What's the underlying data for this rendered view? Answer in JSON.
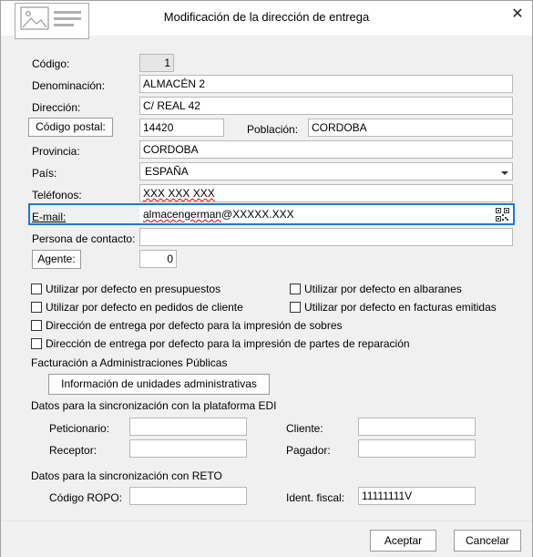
{
  "window": {
    "title": "Modificación de la dirección de entrega",
    "close_glyph": "✕"
  },
  "fields": {
    "codigo": {
      "label": "Código:",
      "value": "1"
    },
    "denominacion": {
      "label": "Denominación:",
      "value": "ALMACÉN 2"
    },
    "direccion": {
      "label": "Dirección:",
      "value": "C/ REAL 42"
    },
    "codigo_postal": {
      "button": "Código postal:",
      "value": "14420"
    },
    "poblacion": {
      "label": "Población:",
      "value": "CORDOBA"
    },
    "provincia": {
      "label": "Provincia:",
      "value": "CORDOBA"
    },
    "pais": {
      "label": "País:",
      "value": "ESPAÑA"
    },
    "telefonos": {
      "label": "Teléfonos:",
      "value": "XXX XXX XXX"
    },
    "email": {
      "label": "E-mail:",
      "value_prefix": "almacengerman",
      "value_suffix": "@XXXXX.XXX"
    },
    "persona_contacto": {
      "label": "Persona de contacto:",
      "value": ""
    },
    "agente": {
      "button": "Agente:",
      "value": "0"
    }
  },
  "checkboxes": [
    {
      "label": "Utilizar por defecto en presupuestos",
      "checked": false
    },
    {
      "label": "Utilizar por defecto en albaranes",
      "checked": false
    },
    {
      "label": "Utilizar por defecto en pedidos de cliente",
      "checked": false
    },
    {
      "label": "Utilizar por defecto en facturas emitidas",
      "checked": false
    },
    {
      "label": "Dirección de entrega por defecto para la impresión de sobres",
      "checked": false
    },
    {
      "label": "Dirección de entrega por defecto para la impresión de partes de reparación",
      "checked": false
    }
  ],
  "facturacion": {
    "heading": "Facturación a Administraciones Públicas",
    "button": "Información de unidades administrativas"
  },
  "edi": {
    "heading": "Datos para la sincronización con la plataforma EDI",
    "peticionario": {
      "label": "Peticionario:",
      "value": ""
    },
    "cliente": {
      "label": "Cliente:",
      "value": ""
    },
    "receptor": {
      "label": "Receptor:",
      "value": ""
    },
    "pagador": {
      "label": "Pagador:",
      "value": ""
    }
  },
  "reto": {
    "heading": "Datos para la sincronización con RETO",
    "codigo_ropo": {
      "label": "Código ROPO:",
      "value": ""
    },
    "ident_fiscal": {
      "label": "Ident. fiscal:",
      "value": "11111111V"
    }
  },
  "footer": {
    "accept": "Aceptar",
    "cancel": "Cancelar"
  },
  "icons": {
    "logo": "address-card-icon",
    "qr": "qr-code-icon",
    "dropdown": "chevron-down-icon"
  },
  "colors": {
    "focus": "#1b7bd0",
    "spellcheck": "#d00"
  }
}
